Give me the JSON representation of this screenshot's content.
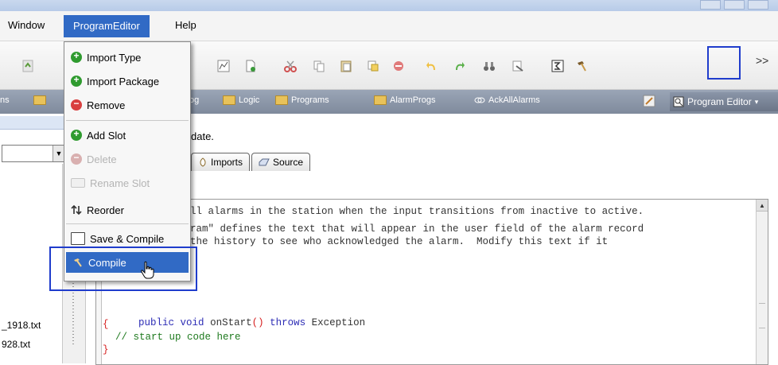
{
  "menubar": {
    "items": [
      {
        "label": "Window"
      },
      {
        "label": "ProgramEditor"
      },
      {
        "label": "Help"
      }
    ]
  },
  "toolbar": {
    "overflow": ">>"
  },
  "bookmarks": {
    "items": [
      "ns",
      "Logic",
      "Programs",
      "AlarmProgs",
      "AckAllAlarms"
    ],
    "partial": [
      "og"
    ],
    "right_tab": "Program Editor"
  },
  "dropdown": {
    "items": [
      {
        "label": "Import Type",
        "icon": "plus-green-icon",
        "enabled": true
      },
      {
        "label": "Import Package",
        "icon": "plus-green-icon",
        "enabled": true
      },
      {
        "label": "Remove",
        "icon": "minus-red-icon",
        "enabled": true
      },
      {
        "label": "Add Slot",
        "icon": "plus-green-icon",
        "enabled": true
      },
      {
        "label": "Delete",
        "icon": "minus-red-icon",
        "enabled": false
      },
      {
        "label": "Rename Slot",
        "icon": "rename-icon",
        "enabled": false
      },
      {
        "label": "Reorder",
        "icon": "reorder-icon",
        "enabled": true
      },
      {
        "label": "Save & Compile",
        "icon": "save-compile-icon",
        "enabled": true
      },
      {
        "label": "Compile",
        "icon": "hammer-icon",
        "enabled": true,
        "selected": true
      }
    ]
  },
  "content": {
    "notice": "date.",
    "tabs": [
      {
        "label": "Imports"
      },
      {
        "label": "Source"
      }
    ],
    "code": {
      "line1": "ll alarms in the station when the input transitions from inactive to active.",
      "line2": "ram\" defines the text that will appear in the user field of the alarm record",
      "line3": "the history to see who acknowledged the alarm.  Modify this text if it",
      "line4_kw1": "public",
      "line4_kw2": "void",
      "line4_method": "onStart",
      "line4_paren": "()",
      "line4_kw3": "throws",
      "line4_exc": "Exception",
      "brace_open": "{",
      "comment": "// start up code here",
      "brace_close": "}"
    }
  },
  "leftnav": {
    "files": [
      "_1918.txt",
      "928.txt"
    ]
  }
}
